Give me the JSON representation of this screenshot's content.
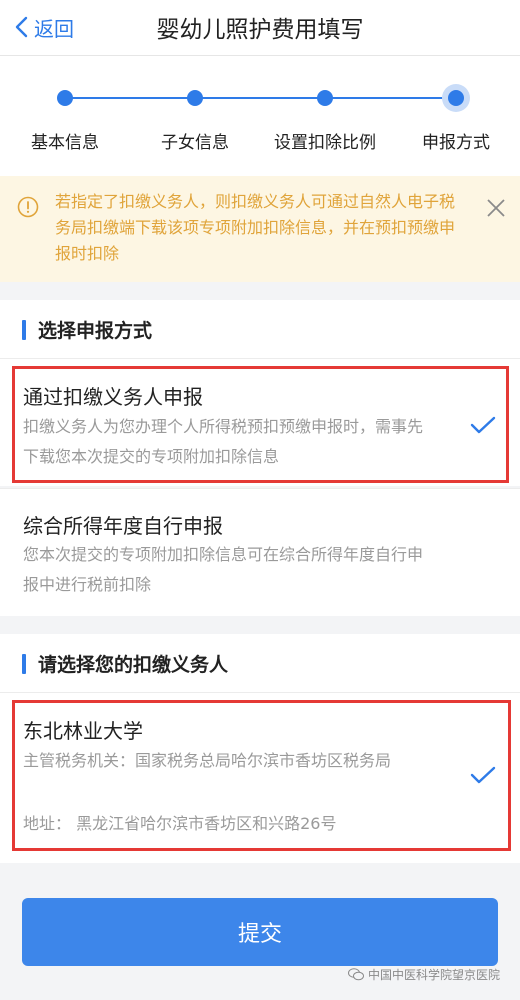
{
  "nav": {
    "back_label": "返回",
    "title": "婴幼儿照护费用填写"
  },
  "steps": [
    {
      "label": "基本信息"
    },
    {
      "label": "子女信息"
    },
    {
      "label": "设置扣除比例"
    },
    {
      "label": "申报方式",
      "active": true
    }
  ],
  "notice": {
    "text": "若指定了扣缴义务人，则扣缴义务人可通过自然人电子税务局扣缴端下载该项专项附加扣除信息，并在预扣预缴申报时扣除"
  },
  "section1": {
    "title": "选择申报方式",
    "options": [
      {
        "title": "通过扣缴义务人申报",
        "desc": "扣缴义务人为您办理个人所得税预扣预缴申报时，需事先下载您本次提交的专项附加扣除信息",
        "selected": true
      },
      {
        "title": "综合所得年度自行申报",
        "desc": "您本次提交的专项附加扣除信息可在综合所得年度自行申报中进行税前扣除",
        "selected": false
      }
    ]
  },
  "section2": {
    "title": "请选择您的扣缴义务人",
    "employer": {
      "name": "东北林业大学",
      "authority": "主管税务机关：国家税务总局哈尔滨市香坊区税务局",
      "address": "地址： 黑龙江省哈尔滨市香坊区和兴路26号",
      "selected": true
    }
  },
  "submit_label": "提交",
  "watermark": "中国中医科学院望京医院",
  "colors": {
    "accent": "#2e7be8",
    "warning_text": "#e0a43a",
    "highlight_box": "#e53935"
  }
}
